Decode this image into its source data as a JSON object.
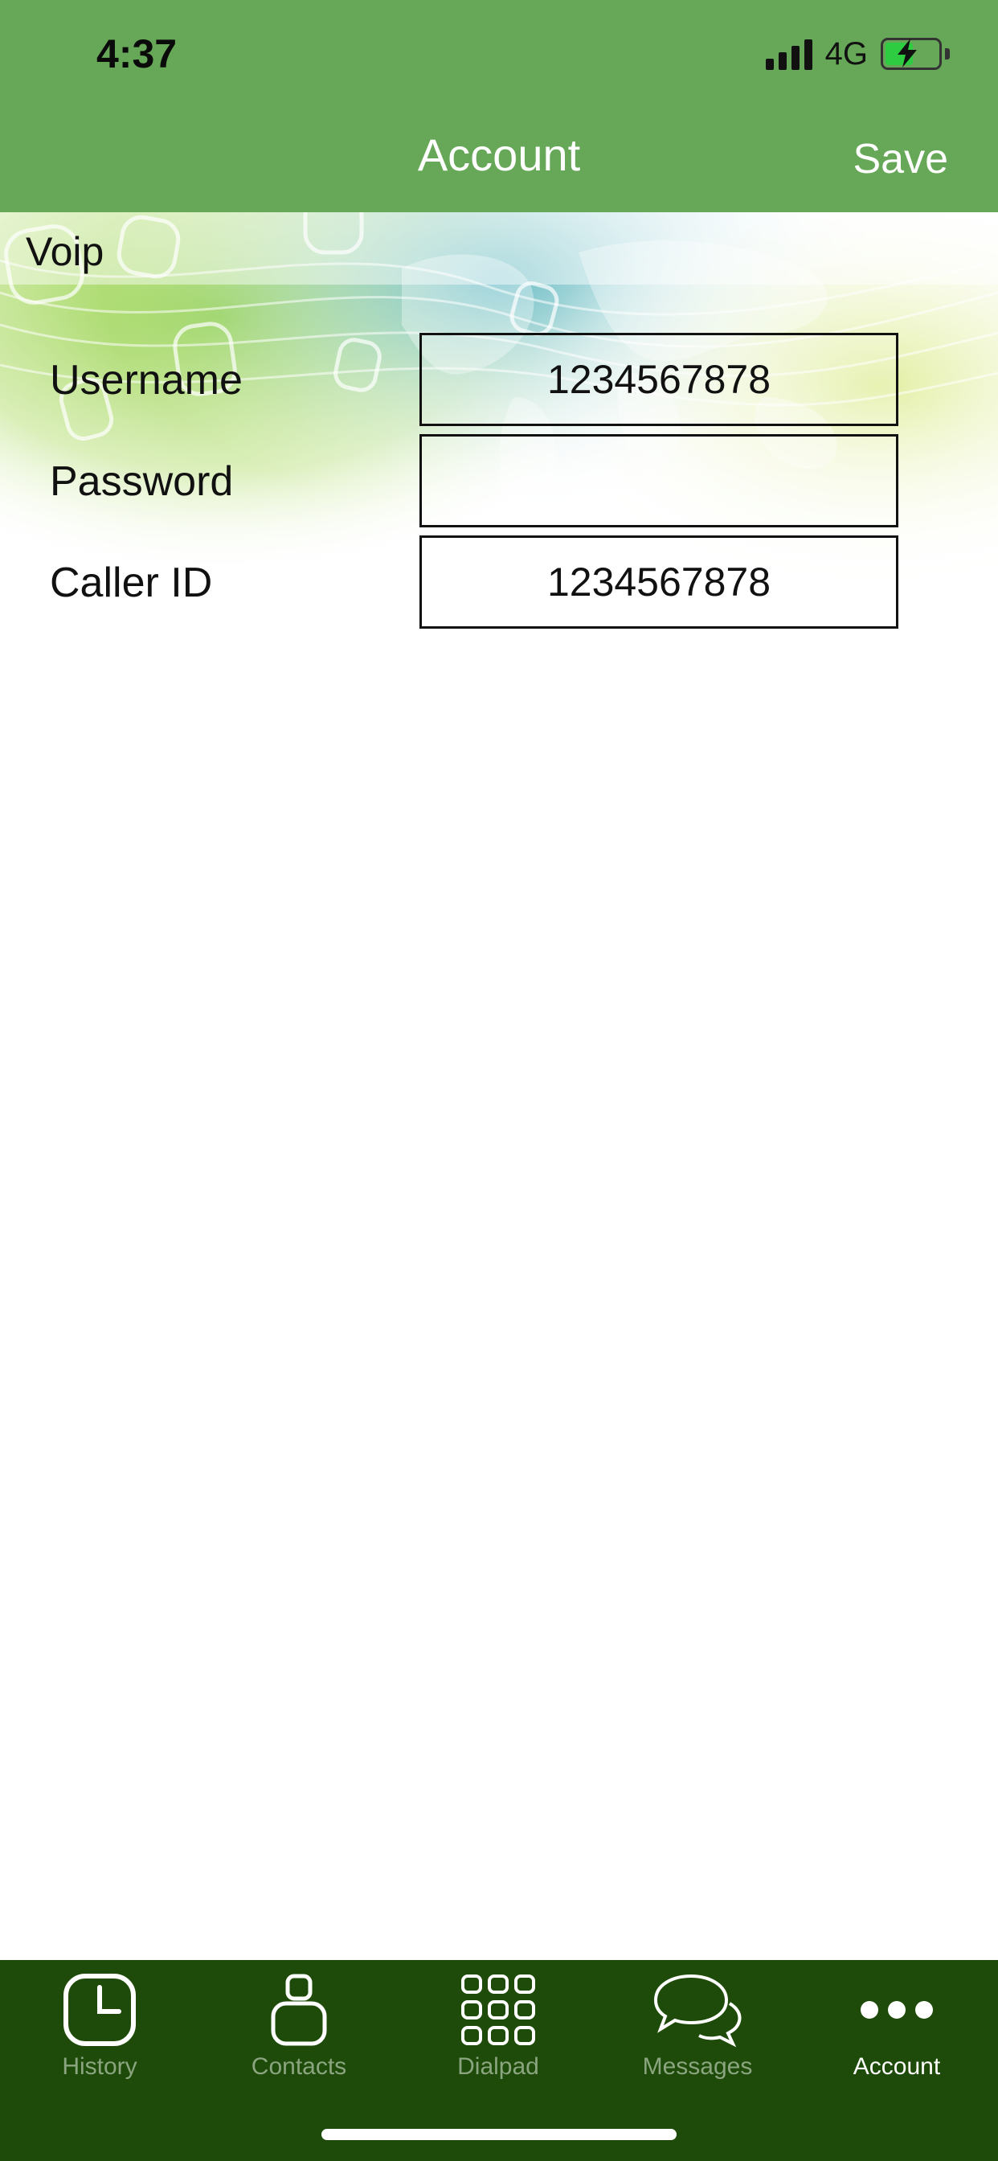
{
  "status_bar": {
    "time": "4:37",
    "network": "4G",
    "battery_charging": true,
    "battery_level": 0.5
  },
  "nav": {
    "title": "Account",
    "save_label": "Save"
  },
  "section": {
    "title": "Voip"
  },
  "form": {
    "username_label": "Username",
    "username_value": "1234567878",
    "password_label": "Password",
    "password_value": "",
    "caller_id_label": "Caller ID",
    "caller_id_value": "1234567878"
  },
  "tabs": [
    {
      "label": "History",
      "icon": "clock-icon",
      "active": false
    },
    {
      "label": "Contacts",
      "icon": "person-icon",
      "active": false
    },
    {
      "label": "Dialpad",
      "icon": "dialpad-icon",
      "active": false
    },
    {
      "label": "Messages",
      "icon": "chat-bubbles-icon",
      "active": false
    },
    {
      "label": "Account",
      "icon": "more-dots-icon",
      "active": true
    }
  ],
  "colors": {
    "nav_bar": "#66a857",
    "tab_bar": "#1e4b09",
    "tab_inactive": "#8aa57f",
    "tab_active": "#ffffff"
  }
}
